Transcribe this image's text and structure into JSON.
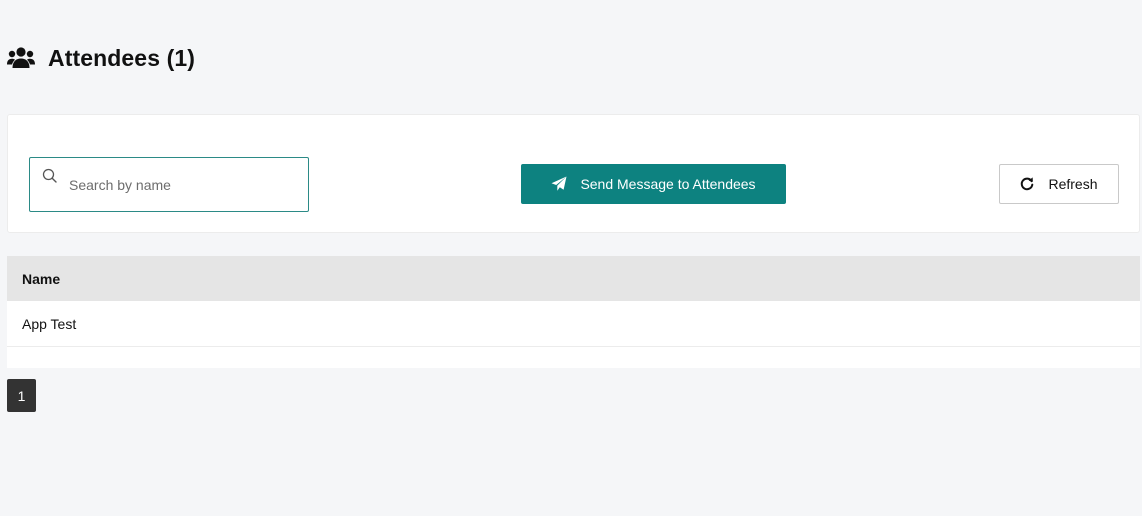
{
  "header": {
    "icon": "users-icon",
    "title": "Attendees (1)"
  },
  "toolbar": {
    "search": {
      "icon": "search-icon",
      "placeholder": "Search by name",
      "value": ""
    },
    "send_button": {
      "icon": "paper-plane-icon",
      "label": "Send Message to Attendees"
    },
    "refresh_button": {
      "icon": "refresh-icon",
      "label": "Refresh"
    }
  },
  "table": {
    "columns": [
      "Name"
    ],
    "rows": [
      [
        "App Test"
      ]
    ]
  },
  "pagination": {
    "current_page": "1",
    "pages": [
      "1"
    ]
  },
  "colors": {
    "accent": "#0d8280",
    "page_background": "#f5f6f8",
    "table_header_background": "#e5e5e5",
    "active_page_background": "#333333"
  }
}
